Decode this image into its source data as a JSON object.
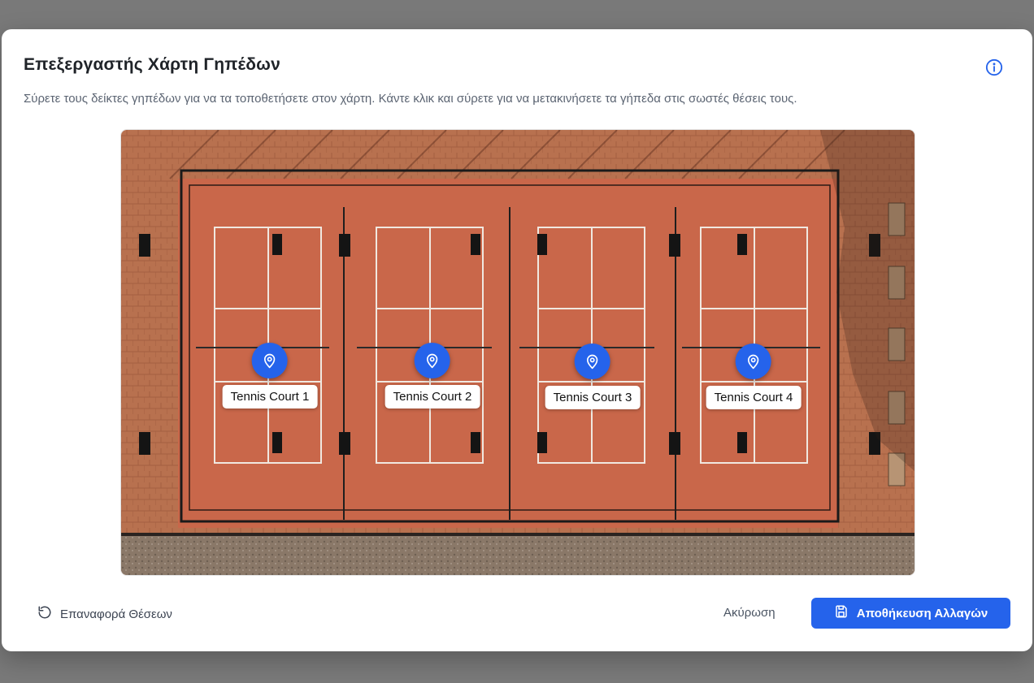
{
  "modal": {
    "title": "Επεξεργαστής Χάρτη Γηπέδων",
    "subtitle": "Σύρετε τους δείκτες γηπέδων για να τα τοποθετήσετε στον χάρτη. Κάντε κλικ και σύρετε για να μετακινήσετε τα γήπεδα στις σωστές θέσεις τους.",
    "info_icon": "info-icon"
  },
  "courts": [
    {
      "label": "Tennis Court 1"
    },
    {
      "label": "Tennis Court 2"
    },
    {
      "label": "Tennis Court 3"
    },
    {
      "label": "Tennis Court 4"
    }
  ],
  "footer": {
    "reset_label": "Επαναφορά Θέσεων",
    "cancel_label": "Ακύρωση",
    "save_label": "Αποθήκευση Αλλαγών"
  },
  "colors": {
    "accent": "#2563eb",
    "clay": "#c9674a"
  }
}
